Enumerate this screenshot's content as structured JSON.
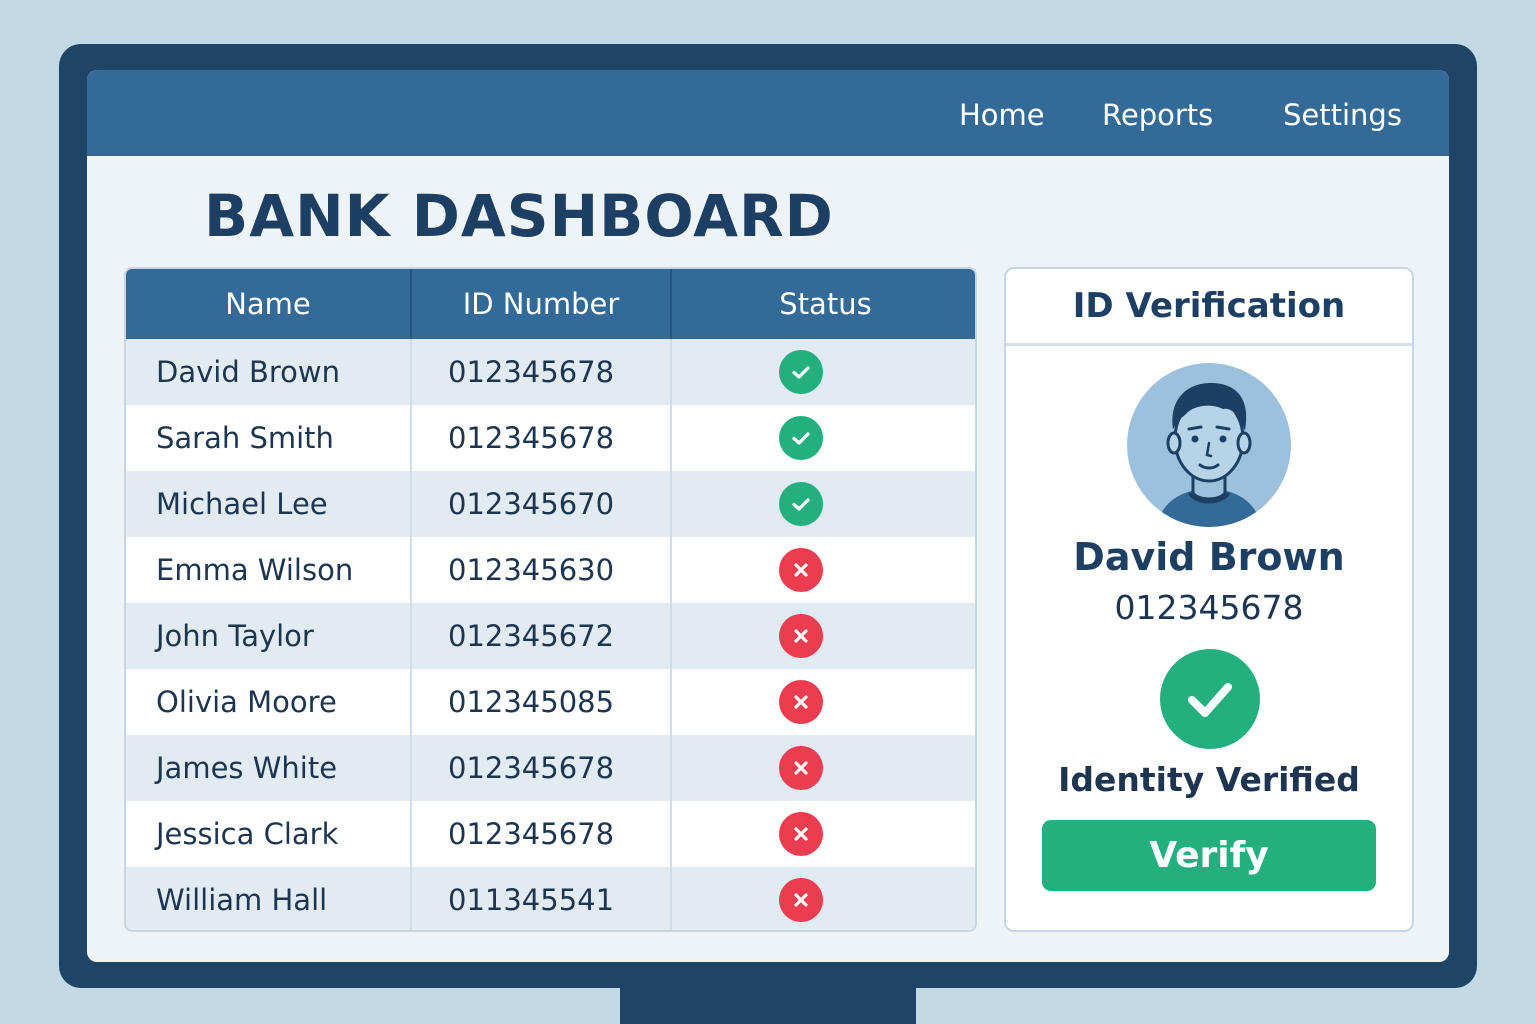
{
  "nav": {
    "items": [
      "Home",
      "Reports",
      "Settings"
    ]
  },
  "page": {
    "title": "BANK DASHBOARD"
  },
  "table": {
    "headers": [
      "Name",
      "ID Number",
      "Status"
    ],
    "rows": [
      {
        "name": "David Brown",
        "id": "012345678",
        "status": "verified"
      },
      {
        "name": "Sarah Smith",
        "id": "012345678",
        "status": "verified"
      },
      {
        "name": "Michael Lee",
        "id": "012345670",
        "status": "verified"
      },
      {
        "name": "Emma Wilson",
        "id": "012345630",
        "status": "failed"
      },
      {
        "name": "John Taylor",
        "id": "012345672",
        "status": "failed"
      },
      {
        "name": "Olivia Moore",
        "id": "012345085",
        "status": "failed"
      },
      {
        "name": "James White",
        "id": "012345678",
        "status": "failed"
      },
      {
        "name": "Jessica Clark",
        "id": "012345678",
        "status": "failed"
      },
      {
        "name": "William Hall",
        "id": "011345541",
        "status": "failed"
      }
    ]
  },
  "verification": {
    "title": "ID Verification",
    "name": "David Brown",
    "id": "012345678",
    "status_text": "Identity Verified",
    "button_label": "Verify",
    "avatar_icon": "user-avatar-icon",
    "status_icon": "check-circle-icon"
  },
  "colors": {
    "primary": "#336a98",
    "dark": "#1f4466",
    "success": "#24b07e",
    "error": "#ec3c4f"
  }
}
